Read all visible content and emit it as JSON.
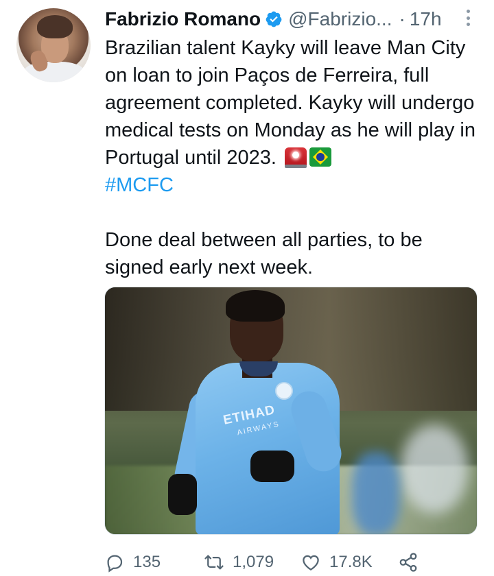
{
  "author": {
    "name": "Fabrizio Romano",
    "handle": "@Fabrizio...",
    "separator": "·",
    "time": "17h",
    "verified": true
  },
  "tweet": {
    "paragraph1": "Brazilian talent Kayky will leave Man City on loan to join Paços de Ferreira, full agreement completed. Kayky will undergo medical tests on Monday as he will play in Portugal until 2023.",
    "emojis": [
      "siren-emoji",
      "brazil-flag-emoji"
    ],
    "hashtag": "#MCFC",
    "paragraph2": "Done deal between all parties, to be signed early next week."
  },
  "photo": {
    "sponsor_line1": "ETIHAD",
    "sponsor_line2": "AIRWAYS"
  },
  "actions": {
    "replies": "135",
    "retweets": "1,079",
    "likes": "17.8K"
  },
  "colors": {
    "link": "#1d9bf0",
    "secondary_text": "#536471",
    "primary_text": "#0f1419",
    "verified_badge": "#1d9bf0"
  }
}
